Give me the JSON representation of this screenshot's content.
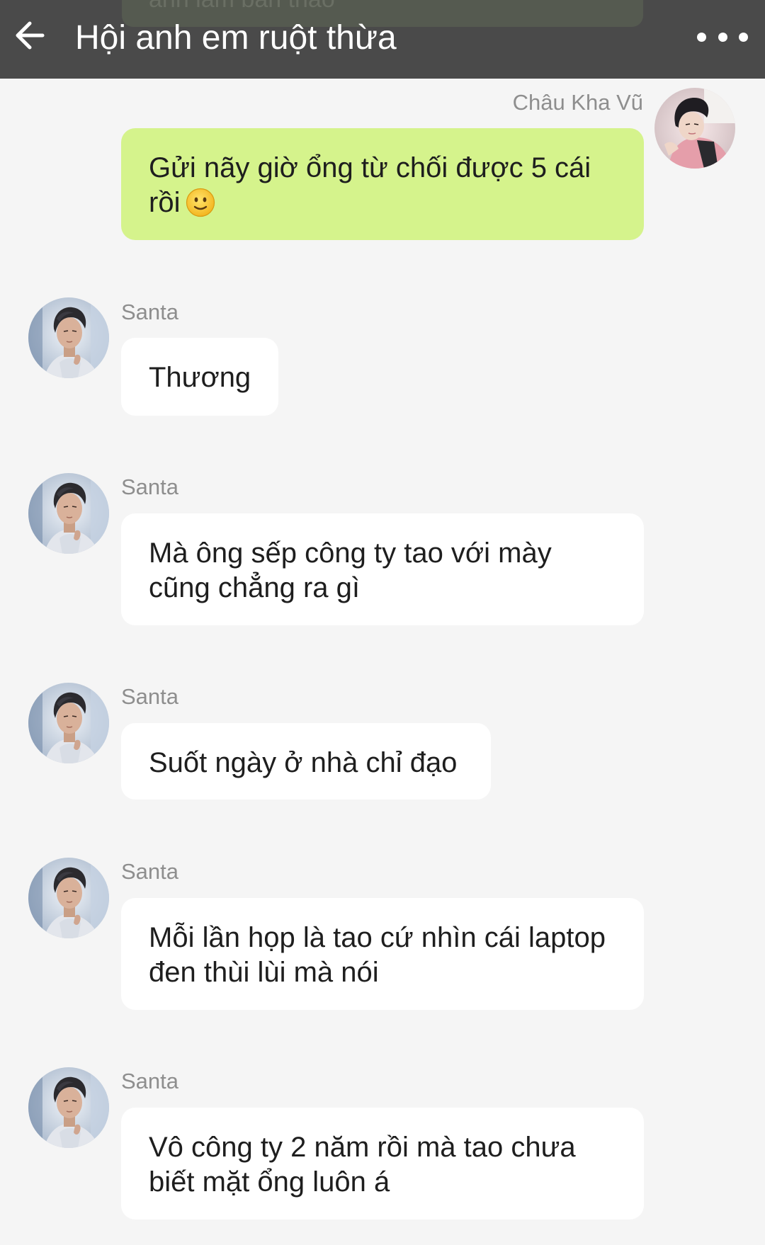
{
  "header": {
    "title": "Hội anh em ruột thừa",
    "back_icon": "arrow-left-icon",
    "more_icon": "more-dots-icon",
    "background": "#4a4a4a"
  },
  "colors": {
    "outgoing_bubble": "#d5f38c",
    "incoming_bubble": "#ffffff",
    "chat_background": "#f5f5f5",
    "sender_name": "#8e8e8e"
  },
  "messages": [
    {
      "direction": "outgoing",
      "sender": "Châu Kha Vũ",
      "text": "Gửi nãy giờ ổng từ chối được 5 cái rồi",
      "emoji": "slightly-smiling-face-icon"
    },
    {
      "direction": "incoming",
      "sender": "Santa",
      "text": "Thương"
    },
    {
      "direction": "incoming",
      "sender": "Santa",
      "text": "Mà ông sếp công ty tao với mày cũng chẳng ra gì"
    },
    {
      "direction": "incoming",
      "sender": "Santa",
      "text": "Suốt ngày ở nhà chỉ đạo"
    },
    {
      "direction": "incoming",
      "sender": "Santa",
      "text": "Mỗi lần họp là tao cứ nhìn cái laptop đen thùi lùi mà nói"
    },
    {
      "direction": "incoming",
      "sender": "Santa",
      "text": "Vô công ty 2 năm rồi mà tao chưa biết mặt ổng luôn á"
    }
  ]
}
